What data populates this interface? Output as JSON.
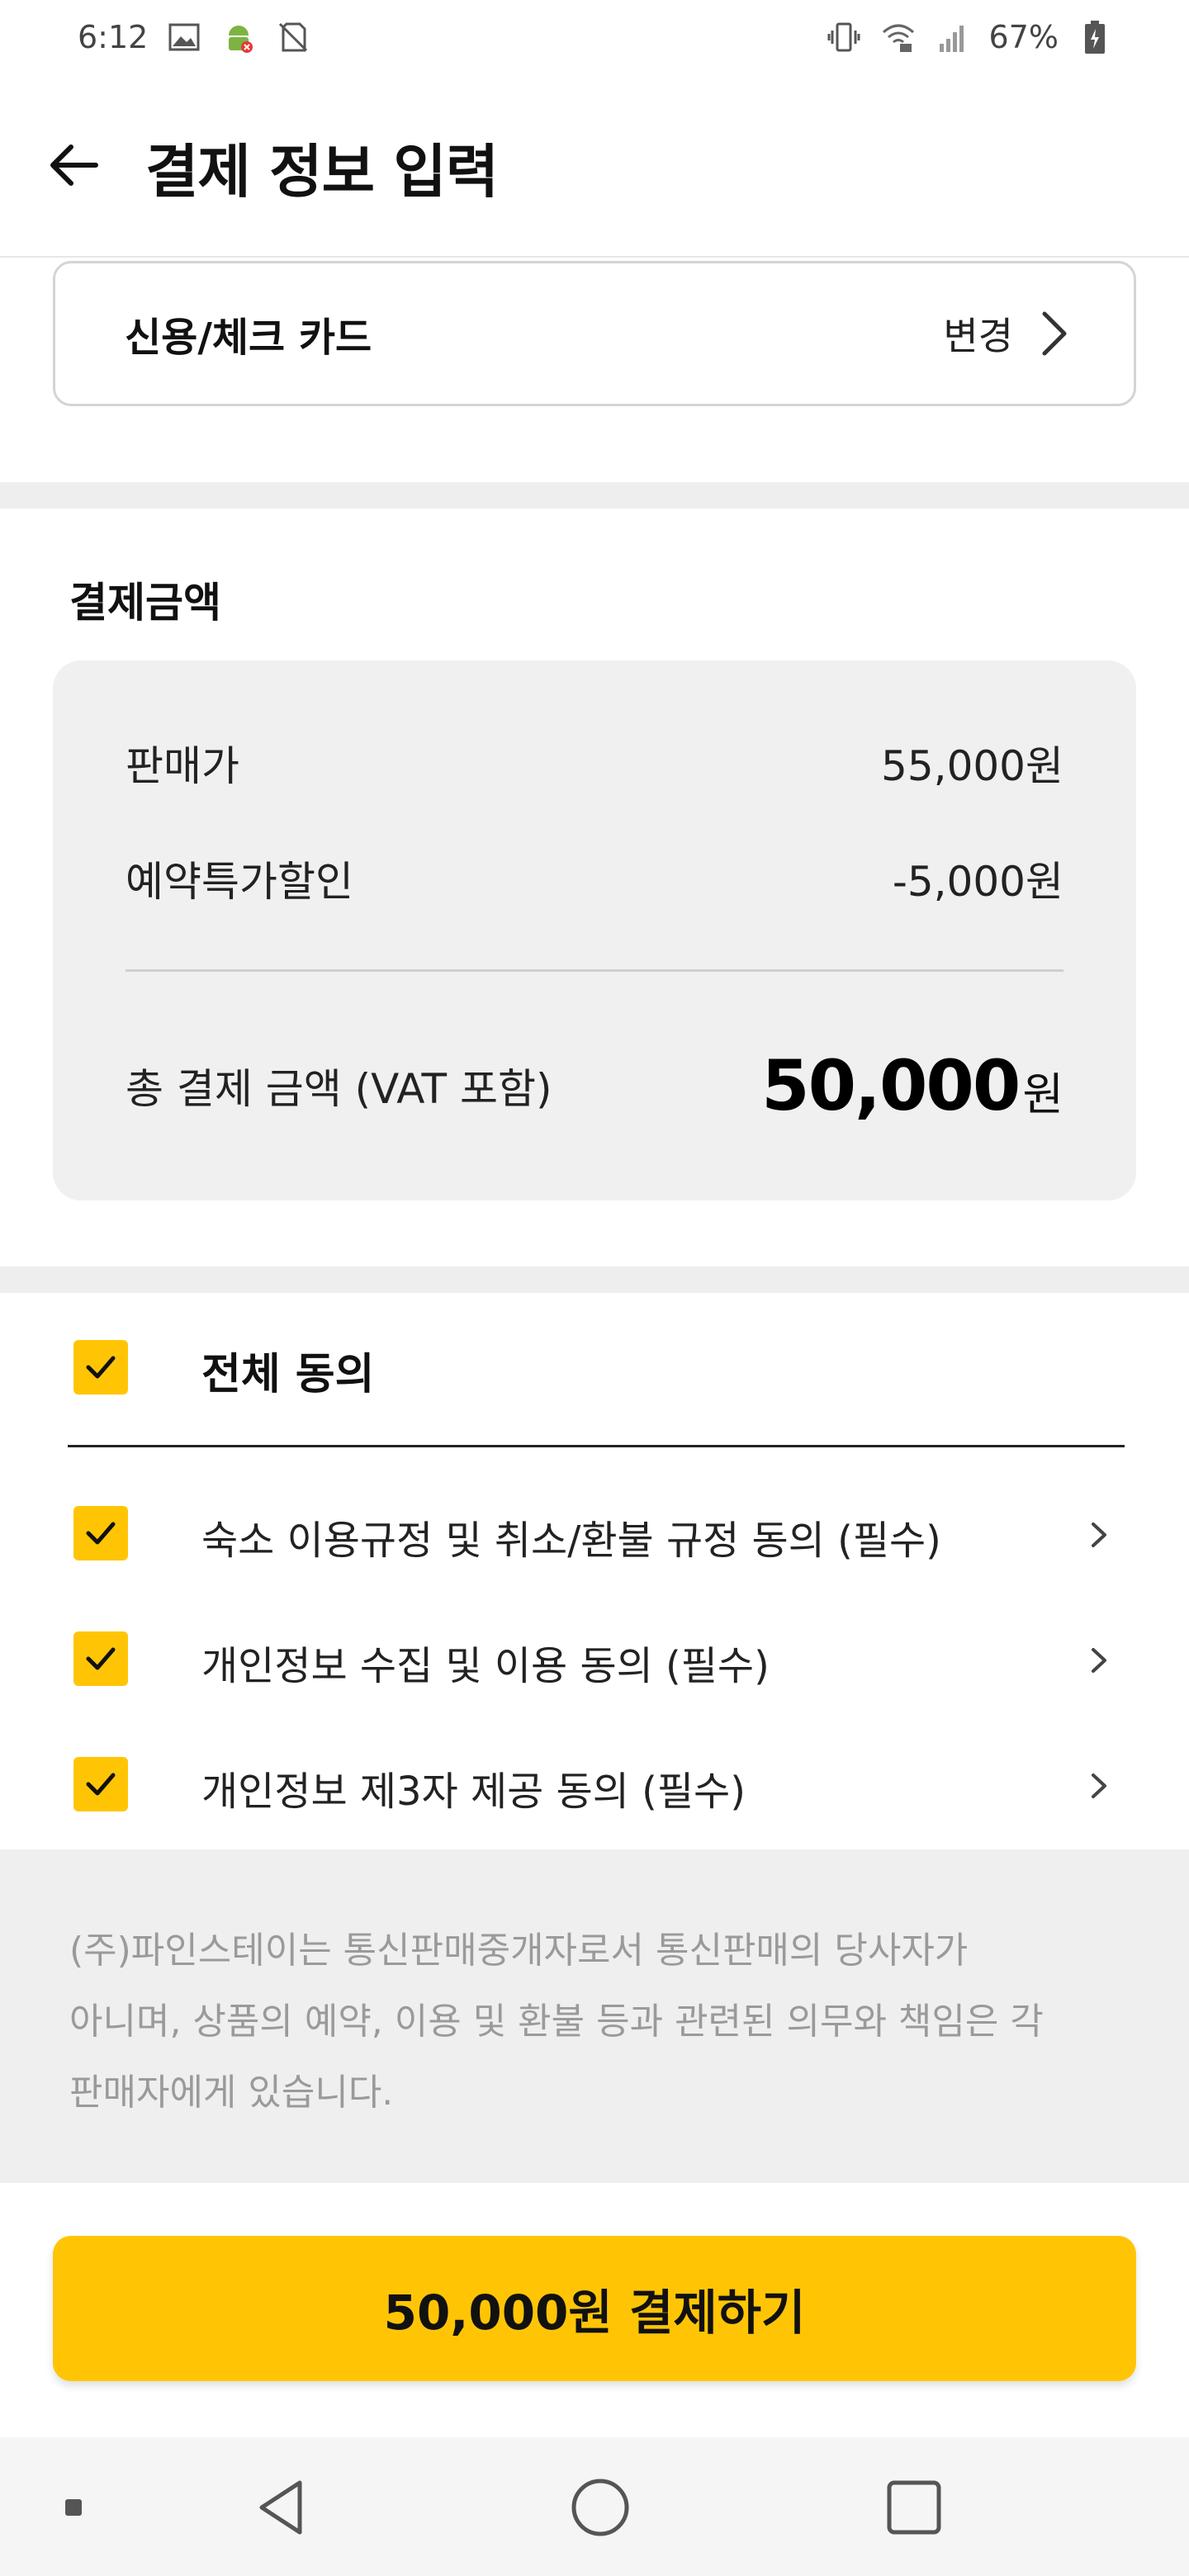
{
  "status_bar": {
    "time": "6:12",
    "battery": "67%",
    "left_icons": [
      "image-icon",
      "android-debug-icon",
      "no-sim-icon"
    ],
    "right_icons": [
      "vibrate-icon",
      "wifi-icon",
      "signal-icon",
      "battery-icon"
    ]
  },
  "header": {
    "back_icon": "arrow-left-icon",
    "title": "결제 정보 입력"
  },
  "payment_method": {
    "name": "신용/체크 카드",
    "change_label": "변경"
  },
  "amount": {
    "section_title": "결제금액",
    "rows": [
      {
        "label": "판매가",
        "value": "55,000원"
      },
      {
        "label": "예약특가할인",
        "value": "-5,000원"
      }
    ],
    "total_label": "총 결제 금액 (VAT 포함)",
    "total_number": "50,000",
    "total_unit": "원"
  },
  "agreements": {
    "all_label": "전체 동의",
    "all_checked": true,
    "items": [
      {
        "label": "숙소 이용규정 및 취소/환불 규정 동의 (필수)",
        "checked": true
      },
      {
        "label": "개인정보 수집 및 이용 동의 (필수)",
        "checked": true
      },
      {
        "label": "개인정보 제3자 제공 동의 (필수)",
        "checked": true
      }
    ]
  },
  "notice": {
    "lines": [
      "(주)파인스테이는 통신판매중개자로서 통신판매의 당사자가",
      "아니며, 상품의 예약, 이용 및 환불 등과 관련된 의무와 책임은 각",
      "판매자에게 있습니다."
    ]
  },
  "pay_button": {
    "label": "50,000원 결제하기"
  },
  "colors": {
    "accent": "#ffc505",
    "card_bg": "#f0f0f0",
    "notice_text": "#9a9a9a"
  },
  "nav_bar": {
    "icons": [
      "menu-dot-icon",
      "back-triangle-icon",
      "home-circle-icon",
      "recents-square-icon"
    ]
  }
}
